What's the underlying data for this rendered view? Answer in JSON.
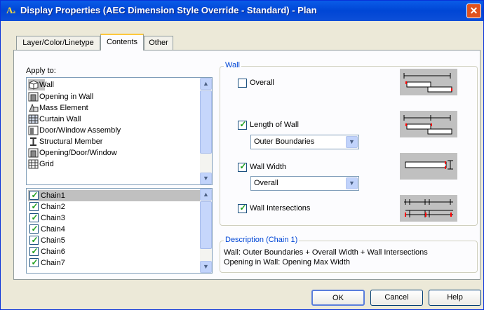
{
  "window": {
    "title": "Display Properties (AEC Dimension Style Override - Standard) - Plan",
    "icon": "autocad-icon",
    "close": "close-icon"
  },
  "tabs": [
    {
      "label": "Layer/Color/Linetype",
      "active": false
    },
    {
      "label": "Contents",
      "active": true
    },
    {
      "label": "Other",
      "active": false
    }
  ],
  "apply_to": {
    "label": "Apply to:",
    "objects": [
      {
        "label": "Wall",
        "icon": "wall-icon",
        "selected": true
      },
      {
        "label": "Opening in Wall",
        "icon": "opening-icon",
        "selected": false
      },
      {
        "label": "Mass Element",
        "icon": "mass-element-icon",
        "selected": false
      },
      {
        "label": "Curtain Wall",
        "icon": "curtain-wall-icon",
        "selected": false
      },
      {
        "label": "Door/Window Assembly",
        "icon": "door-window-assembly-icon",
        "selected": false
      },
      {
        "label": "Structural Member",
        "icon": "structural-member-icon",
        "selected": false
      },
      {
        "label": "Opening/Door/Window",
        "icon": "opening-icon",
        "selected": false
      },
      {
        "label": "Grid",
        "icon": "grid-icon",
        "selected": false
      }
    ],
    "chains": [
      {
        "label": "Chain1",
        "checked": true,
        "selected": true
      },
      {
        "label": "Chain2",
        "checked": true,
        "selected": false
      },
      {
        "label": "Chain3",
        "checked": true,
        "selected": false
      },
      {
        "label": "Chain4",
        "checked": true,
        "selected": false
      },
      {
        "label": "Chain5",
        "checked": true,
        "selected": false
      },
      {
        "label": "Chain6",
        "checked": true,
        "selected": false
      },
      {
        "label": "Chain7",
        "checked": true,
        "selected": false
      }
    ]
  },
  "wall_group": {
    "title": "Wall",
    "overall": {
      "label": "Overall",
      "checked": false
    },
    "length_of_wall": {
      "label": "Length of Wall",
      "checked": true,
      "select_value": "Outer Boundaries"
    },
    "wall_width": {
      "label": "Wall Width",
      "checked": true,
      "select_value": "Overall"
    },
    "wall_intersections": {
      "label": "Wall Intersections",
      "checked": true
    }
  },
  "description": {
    "title": "Description (Chain 1)",
    "line1": "Wall: Outer Boundaries + Overall Width + Wall Intersections",
    "line2": "Opening in Wall: Opening Max Width"
  },
  "buttons": {
    "ok": "OK",
    "cancel": "Cancel",
    "help": "Help"
  },
  "colors": {
    "title_bar": "#0054e3",
    "group_title": "#0046d5",
    "checkmark": "#21a121",
    "preview_marker": "#ff0000"
  }
}
